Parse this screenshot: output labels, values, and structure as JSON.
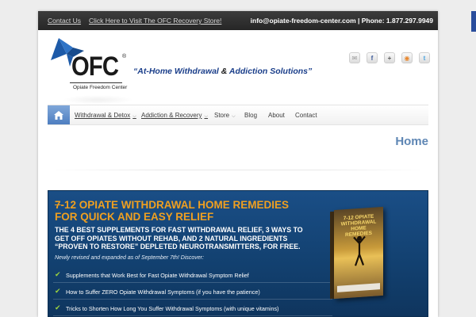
{
  "topbar": {
    "contact_link": "Contact Us",
    "store_link": "Click Here to Visit The OFC Recovery Store!",
    "info": "info@opiate-freedom-center.com | Phone: 1.877.297.9949"
  },
  "logo": {
    "name": "OFC",
    "registered": "®",
    "subtitle": "Opiate Freedom Center"
  },
  "tagline": {
    "part1": "“At-Home Withdrawal ",
    "amp": "&",
    "part2": " Addiction Solutions”"
  },
  "socials": [
    "mail-icon",
    "facebook-icon",
    "google-plus-icon",
    "rss-icon",
    "twitter-icon"
  ],
  "nav": {
    "items": [
      {
        "label": "Withdrawal & Detox",
        "dropdown": true
      },
      {
        "label": "Addiction & Recovery",
        "dropdown": true
      },
      {
        "label": "Store",
        "dropdown": true
      },
      {
        "label": "Blog",
        "dropdown": false
      },
      {
        "label": "About",
        "dropdown": false
      },
      {
        "label": "Contact",
        "dropdown": false
      }
    ]
  },
  "page": {
    "heading": "Home"
  },
  "banner": {
    "title_strike": "7",
    "title_rest": "-12 OPIATE WITHDRAWAL HOME REMEDIES FOR QUICK AND EASY RELIEF",
    "subtitle": "THE 4 BEST SUPPLEMENTS FOR FAST WITHDRAWAL RELIEF, 3 WAYS TO GET OFF OPIATES WITHOUT REHAB, AND 2 NATURAL INGREDIENTS “PROVEN TO RESTORE” DEPLETED NEUROTRANSMITTERS, FOR FREE.",
    "note": "Newly revised and expanded as of September 7th! Discover:",
    "bullets": [
      "Supplements that Work Best for Fast Opiate Withdrawal Symptom Relief",
      "How to Suffer ZERO Opiate Withdrawal Symptoms (if you have the patience)",
      "Tricks to Shorten How Long You Suffer Withdrawal Symptoms (with unique vitamins)"
    ],
    "book_title": "7-12 OPIATE WITHDRAWAL HOME REMEDIES"
  },
  "colors": {
    "accent": "#2a4d9c",
    "banner_title": "#f0a020",
    "heading": "#5e86b4",
    "check": "#9bd23f"
  }
}
